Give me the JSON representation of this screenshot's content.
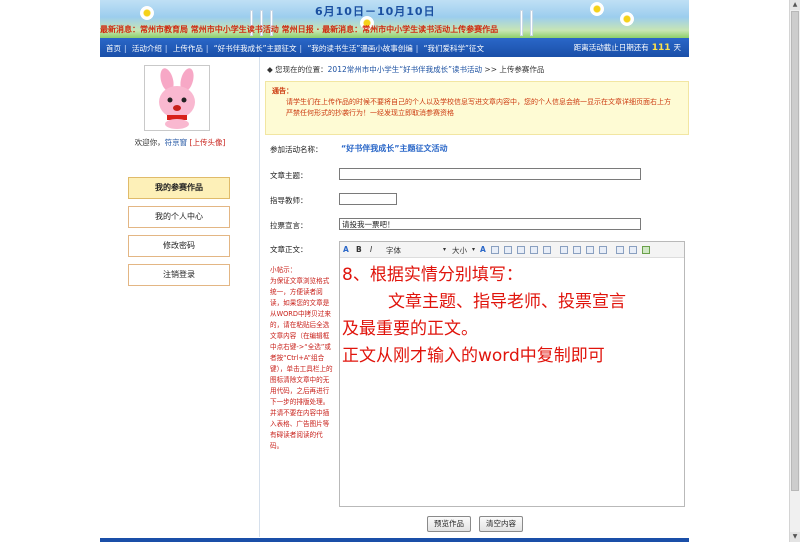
{
  "banner": {
    "dates": "6月10日－10月10日",
    "scroll_text": "最新消息：常州市教育局 常州市中小学生读书活动 常州日报 · 最新消息：常州市中小学生读书活动上传参赛作品"
  },
  "nav": {
    "links": [
      "首页",
      "活动介绍",
      "上传作品",
      "“好书伴我成长”主题征文",
      "“我的读书生活”漫画小故事创编",
      "“我们爱科学”征文"
    ],
    "countdown_prefix": "距离活动截止日期还有",
    "countdown_days": "111",
    "countdown_suffix": "天"
  },
  "sidebar": {
    "welcome_prefix": "欢迎你，",
    "username": "符京窗",
    "upload_avatar": "[上传头像]",
    "items": [
      {
        "label": "我的参赛作品",
        "active": true
      },
      {
        "label": "我的个人中心",
        "active": false
      },
      {
        "label": "修改密码",
        "active": false
      },
      {
        "label": "注销登录",
        "active": false
      }
    ]
  },
  "breadcrumb": {
    "prefix": "◆ 您现在的位置：",
    "link": "2012常州市中小学生“好书伴我成长”读书活动",
    "sep": ">>",
    "current": "上传参赛作品"
  },
  "notice": {
    "title": "通告：",
    "line1": "请学生们在上传作品的时候不要将自己的个人以及学校信息写进文章内容中，您的个人信息会统一显示在文章详细页面右上方",
    "line2": "严禁任何形式的抄袭行为！一经发现立即取消参赛资格"
  },
  "form": {
    "activity_label": "参加活动名称：",
    "activity_name": "“好书伴我成长”主题征文活动",
    "title_label": "文章主题：",
    "title_value": "",
    "teacher_label": "指导教师：",
    "teacher_value": "",
    "slogan_label": "拉票宣言：",
    "slogan_value": "请投我一票吧！",
    "body_label": "文章正文："
  },
  "tips": {
    "title": "小帖示：",
    "text": "为保证文章浏览格式统一，方便读者阅读，如果您的文章是从WORD中拷贝过来的，请在粘贴后全选文章内容（在编辑框中点右键->“全选”或者按“Ctrl+A”组合键），单击工具栏上的 图标清除文章中的无用代码，之后再进行下一步的排版处理。并请不要在内容中插入表格、广告图片等有碍读者阅读的代码。"
  },
  "editor": {
    "font_label": "字体",
    "size_label": "大小",
    "content": {
      "line1": "8、根据实情分别填写：",
      "line2": "文章主题、指导老师、投票宣言",
      "line3": "及最重要的正文。",
      "line4": "正文从刚才输入的word中复制即可"
    }
  },
  "buttons": {
    "preview": "预览作品",
    "clear": "清空内容"
  },
  "colors": {
    "nav_blue": "#1a4fa8",
    "notice_bg": "#fefbd4",
    "annotation_red": "#e0140c",
    "active_item_bg": "#fdf0b8"
  }
}
